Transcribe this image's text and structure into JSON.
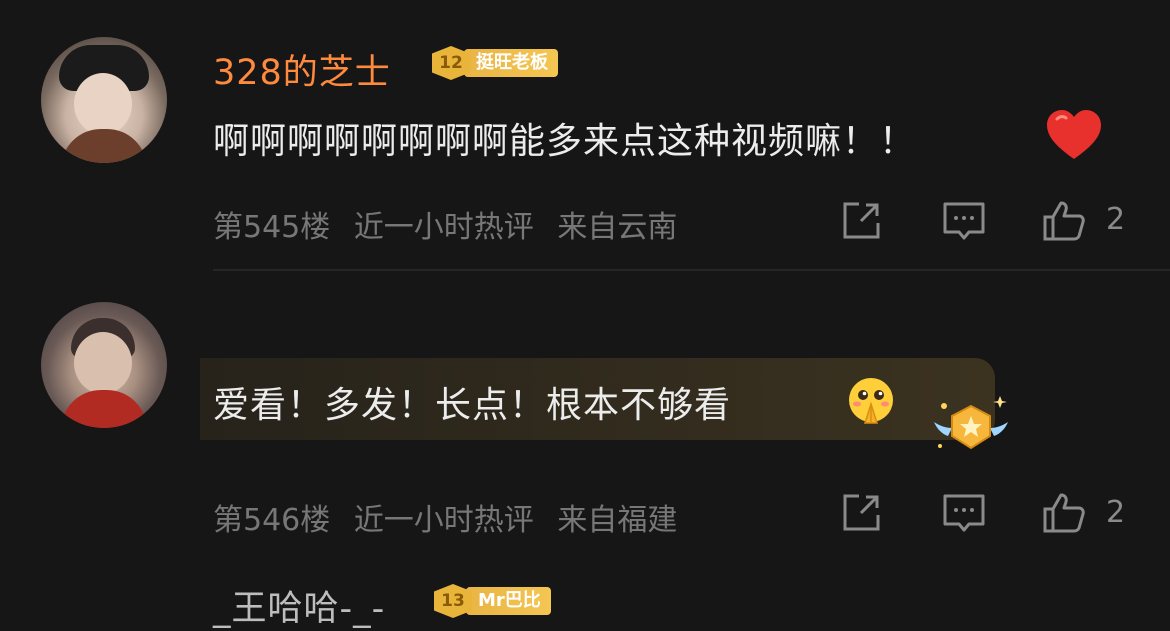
{
  "comments": [
    {
      "username": "328的芝士",
      "badge": {
        "level": "12",
        "label": "挺旺老板"
      },
      "text": "啊啊啊啊啊啊啊啊能多来点这种视频嘛！！",
      "meta": {
        "floor": "第545楼",
        "time": "近一小时热评",
        "location": "来自云南"
      },
      "likes": "2"
    },
    {
      "username": "_王哈哈-_-",
      "badge": {
        "level": "13",
        "label": "Mr巴比"
      },
      "text": "爱看！多发！长点！根本不够看",
      "meta": {
        "floor": "第546楼",
        "time": "近一小时热评",
        "location": "来自福建"
      },
      "likes": "2"
    }
  ],
  "colors": {
    "background": "#161616",
    "username_highlight": "#ff8a3d",
    "badge_gold": "#e9b445",
    "meta_gray": "#777777"
  },
  "icons": [
    "heart-icon",
    "share-icon",
    "reply-icon",
    "like-icon",
    "pray-emoji-icon",
    "crown-badge-icon"
  ]
}
